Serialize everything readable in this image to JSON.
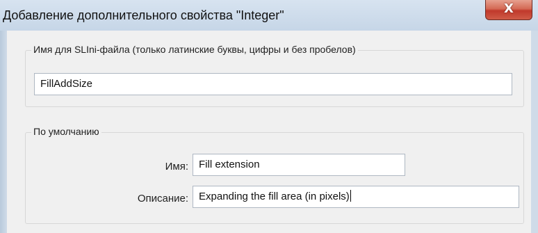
{
  "window": {
    "title": "Добавление дополнительного свойства \"Integer\"",
    "close_glyph": "X"
  },
  "ini_group": {
    "legend": "Имя для SLIni-файла (только латинские буквы, цифры и без пробелов)",
    "value": "FillAddSize"
  },
  "default_group": {
    "legend": "По умолчанию",
    "name_label": "Имя:",
    "name_value": "Fill extension",
    "description_label": "Описание:",
    "description_value": "Expanding the fill area (in pixels)"
  },
  "colors": {
    "titlebar": "#cfdbe8",
    "client": "#f0f0f0",
    "close_button": "#c0392b"
  },
  "icons": {
    "close": "close-icon"
  }
}
